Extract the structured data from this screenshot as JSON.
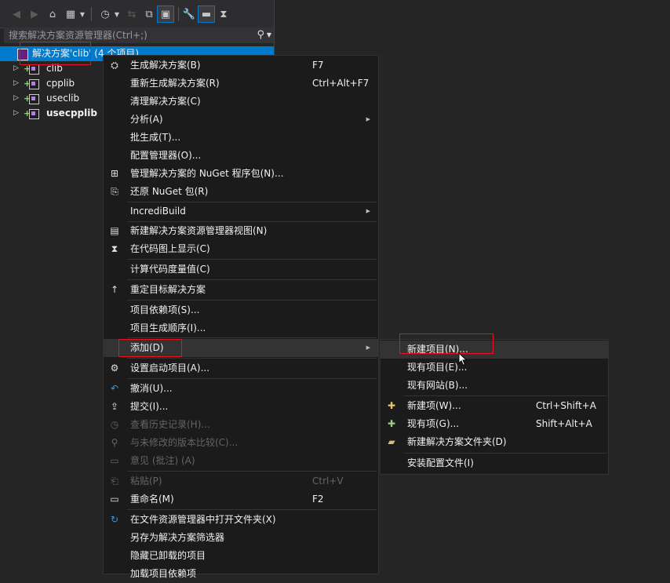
{
  "search": {
    "placeholder": "搜索解决方案资源管理器(Ctrl+;)"
  },
  "tree": {
    "solution": "解决方案'clib' (4 个项目)",
    "projects": [
      {
        "label": "clib",
        "bold": false
      },
      {
        "label": "cpplib",
        "bold": false
      },
      {
        "label": "useclib",
        "bold": false
      },
      {
        "label": "usecpplib",
        "bold": true
      }
    ]
  },
  "menu": {
    "items": [
      {
        "label": "生成解决方案(B)",
        "shortcut": "F7",
        "icon": "build-icon"
      },
      {
        "label": "重新生成解决方案(R)",
        "shortcut": "Ctrl+Alt+F7"
      },
      {
        "label": "清理解决方案(C)"
      },
      {
        "label": "分析(A)",
        "submenu": true
      },
      {
        "label": "批生成(T)..."
      },
      {
        "label": "配置管理器(O)..."
      },
      {
        "label": "管理解决方案的 NuGet 程序包(N)...",
        "icon": "nuget-icon"
      },
      {
        "label": "还原 NuGet 包(R)",
        "icon": "restore-icon"
      },
      {
        "label": "IncrediBuild",
        "submenu": true
      },
      {
        "label": "新建解决方案资源管理器视图(N)",
        "icon": "new-view-icon"
      },
      {
        "label": "在代码图上显示(C)",
        "icon": "code-map-icon"
      },
      {
        "label": "计算代码度量值(C)"
      },
      {
        "label": "重定目标解决方案",
        "icon": "arrow-up-icon"
      },
      {
        "label": "项目依赖项(S)..."
      },
      {
        "label": "项目生成顺序(I)..."
      },
      {
        "label": "添加(D)",
        "submenu": true
      },
      {
        "label": "设置启动项目(A)...",
        "icon": "gear-icon"
      },
      {
        "label": "撤消(U)...",
        "icon": "undo-icon"
      },
      {
        "label": "提交(I)...",
        "icon": "commit-icon"
      },
      {
        "label": "查看历史记录(H)...",
        "icon": "history-icon",
        "disabled": true
      },
      {
        "label": "与未修改的版本比较(C)...",
        "icon": "compare-icon",
        "disabled": true
      },
      {
        "label": "意见 (批注) (A)",
        "icon": "comment-icon",
        "disabled": true
      },
      {
        "label": "粘贴(P)",
        "shortcut": "Ctrl+V",
        "icon": "paste-icon",
        "disabled": true
      },
      {
        "label": "重命名(M)",
        "shortcut": "F2",
        "icon": "rename-icon"
      },
      {
        "label": "在文件资源管理器中打开文件夹(X)",
        "icon": "refresh-icon"
      },
      {
        "label": "另存为解决方案筛选器"
      },
      {
        "label": "隐藏已卸载的项目"
      },
      {
        "label": "加载项目依赖项"
      }
    ]
  },
  "submenu": {
    "items": [
      {
        "label": "新建项目(N)..."
      },
      {
        "label": "现有项目(E)..."
      },
      {
        "label": "现有网站(B)..."
      },
      {
        "label": "新建项(W)...",
        "shortcut": "Ctrl+Shift+A",
        "icon": "new-item-icon"
      },
      {
        "label": "现有项(G)...",
        "shortcut": "Shift+Alt+A",
        "icon": "existing-item-icon"
      },
      {
        "label": "新建解决方案文件夹(D)",
        "icon": "new-folder-icon"
      },
      {
        "label": "安装配置文件(I)"
      }
    ]
  },
  "colors": {
    "accent": "#007acc",
    "highlight_box": "#e81123",
    "menu_bg": "#1b1b1c"
  }
}
